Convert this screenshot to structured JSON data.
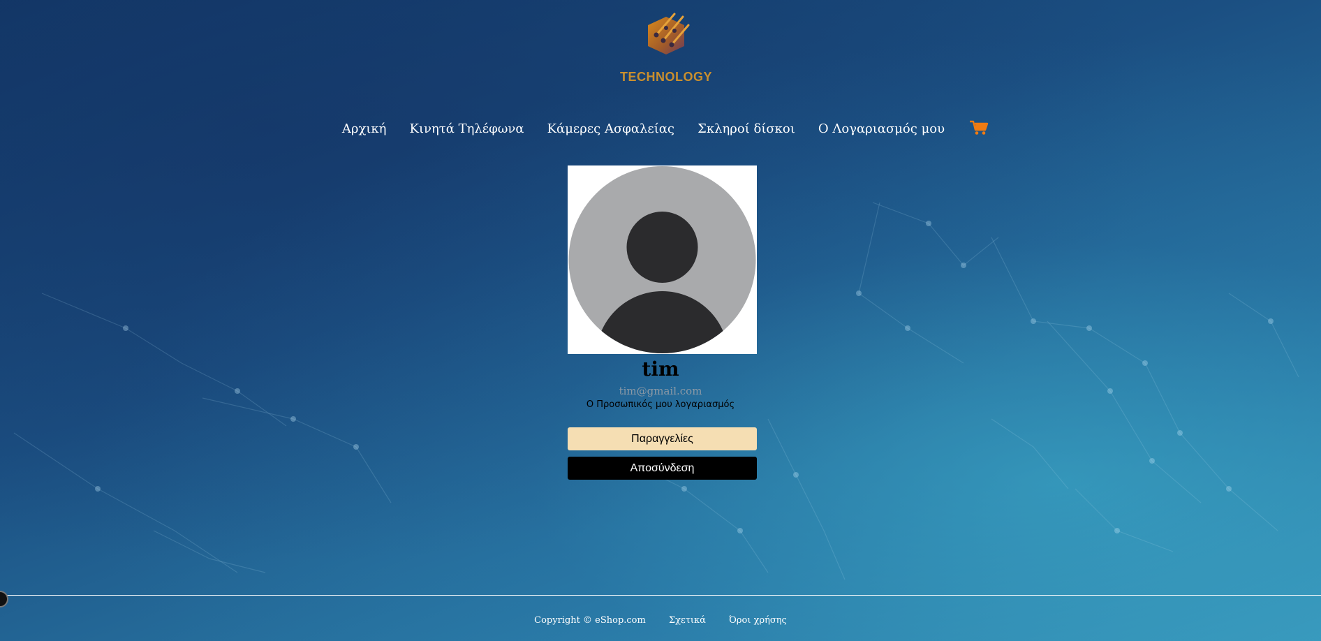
{
  "brand": {
    "logo_text": "TECHNOLOGY",
    "logo_color": "#c98f2e"
  },
  "nav": {
    "items": [
      {
        "label": "Αρχική"
      },
      {
        "label": "Κινητά Τηλέφωνα"
      },
      {
        "label": "Κάμερες Ασφαλείας"
      },
      {
        "label": "Σκληροί δίσκοι"
      },
      {
        "label": "Ο Λογαριασμός μου"
      }
    ],
    "cart_icon": "cart-icon",
    "cart_color": "#f07b12"
  },
  "profile": {
    "avatar_icon": "default-avatar-icon",
    "username": "tim",
    "email": "tim@gmail.com",
    "subtitle": "Ο Προσωπικός μου λογαριασμός",
    "orders_label": "Παραγγελίες",
    "logout_label": "Αποσύνδεση",
    "orders_color": "#f5deb3",
    "logout_color": "#000000"
  },
  "footer": {
    "copyright": "Copyright © eShop.com",
    "about": "Σχετικά",
    "terms": "Όροι χρήσης"
  }
}
